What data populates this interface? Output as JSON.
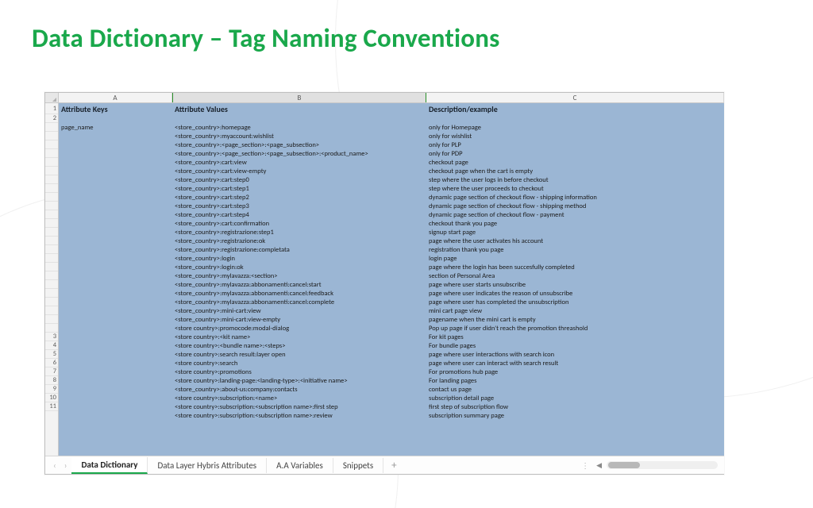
{
  "title": "Data Dictionary – Tag Naming Conventions",
  "sheet": {
    "cols": [
      "A",
      "B",
      "C"
    ],
    "header": {
      "a": "Attribute Keys",
      "b": "Attribute Values",
      "c": "Description/example"
    },
    "row_numbers": [
      "1",
      "2",
      "",
      "",
      "",
      "",
      "",
      "",
      "",
      "",
      "",
      "",
      "",
      "",
      "",
      "",
      "",
      "",
      "",
      "",
      "",
      "",
      "",
      "",
      "",
      "",
      "3",
      "4",
      "5",
      "6",
      "7",
      "8",
      "9",
      "10",
      "11"
    ],
    "rows": [
      {
        "a": "",
        "b": "",
        "c": ""
      },
      {
        "a": "page_name",
        "b": "<store_country>:homepage",
        "c": "only for Homepage"
      },
      {
        "a": "",
        "b": "<store_country>:myaccount:wishlist",
        "c": "only for wishlist"
      },
      {
        "a": "",
        "b": "<store_country>:<page_section>:<page_subsection>",
        "c": "only for PLP"
      },
      {
        "a": "",
        "b": "<store_country>:<page_section>:<page_subsection>:<product_name>",
        "c": "only for PDP"
      },
      {
        "a": "",
        "b": "<store_country>:cart:view",
        "c": "checkout page"
      },
      {
        "a": "",
        "b": "<store_country>:cart:view-empty",
        "c": "checkout page when the cart is empty"
      },
      {
        "a": "",
        "b": "<store_country>:cart:step0",
        "c": "step where the user logs in before checkout"
      },
      {
        "a": "",
        "b": "<store_country>:cart:step1",
        "c": "step where the user proceeds to checkout"
      },
      {
        "a": "",
        "b": "<store_country>:cart:step2",
        "c": "dynamic page section of checkout flow - shipping information"
      },
      {
        "a": "",
        "b": "<store_country>:cart:step3",
        "c": "dynamic page section of checkout flow - shipping method"
      },
      {
        "a": "",
        "b": "<store_country>:cart:step4",
        "c": "dynamic page section of checkout flow - payment"
      },
      {
        "a": "",
        "b": "<store_country>:cart:confirmation",
        "c": "checkout thank you page"
      },
      {
        "a": "",
        "b": "<store_country>:registrazione:step1",
        "c": "signup start page"
      },
      {
        "a": "",
        "b": "<store_country>:registrazione:ok",
        "c": "page where the user activates his account"
      },
      {
        "a": "",
        "b": "<store_country>:registrazione:completata",
        "c": "registration thank you page"
      },
      {
        "a": "",
        "b": "<store_country>:login",
        "c": "login page"
      },
      {
        "a": "",
        "b": "<store_country>:login:ok",
        "c": "page where the login has been succesfully completed"
      },
      {
        "a": "",
        "b": "<store_country>:mylavazza:<section>",
        "c": "section of Personal Area"
      },
      {
        "a": "",
        "b": "<store_country>:mylavazza:abbonamenti:cancel:start",
        "c": "page where user starts unsubscribe"
      },
      {
        "a": "",
        "b": "<store_country>:mylavazza:abbonamenti:cancel:feedback",
        "c": "page where user indicates the reason of unsubscribe"
      },
      {
        "a": "",
        "b": "<store_country>:mylavazza:abbonamenti:cancel:complete",
        "c": "page where user has completed the unsubscription"
      },
      {
        "a": "",
        "b": "<store_country>:mini-cart:view",
        "c": "mini cart page view"
      },
      {
        "a": "",
        "b": "<store_country>:mini-cart:view-empty",
        "c": "pagename when the mini cart is empty"
      },
      {
        "a": "",
        "b": "<store country>:promocode:modal-dialog",
        "c": "Pop up page if user didn't reach the promotion threashold"
      },
      {
        "a": "",
        "b": "<store country>:<kit name>",
        "c": "For kit pages"
      },
      {
        "a": "",
        "b": "<store country>:<bundle name>:<steps>",
        "c": "For bundle pages"
      },
      {
        "a": "",
        "b": "<store country>:search result:layer open",
        "c": "page where user interactions with search icon"
      },
      {
        "a": "",
        "b": "<store country>:search",
        "c": "page where user can interact with search result"
      },
      {
        "a": "",
        "b": "<store country>:promotions",
        "c": "For promotions hub page"
      },
      {
        "a": "",
        "b": "<store country>:landing-page:<landing-type>:<initiative name>",
        "c": "For landing pages"
      },
      {
        "a": "",
        "b": "<store_country>:about-us:company:contacts",
        "c": "contact us page"
      },
      {
        "a": "",
        "b": "<store country>:subscription:<name>",
        "c": "subscription detail page"
      },
      {
        "a": "",
        "b": "<store country>:subscription:<subscription name>:first step",
        "c": "first step of subscription flow"
      },
      {
        "a": "",
        "b": "<store country>:subscription:<subscription name>:review",
        "c": "subscription summary page"
      }
    ]
  },
  "tabs": [
    "Data Dictionary",
    "Data Layer Hybris Attributes",
    "A.A Variables",
    "Snippets"
  ]
}
